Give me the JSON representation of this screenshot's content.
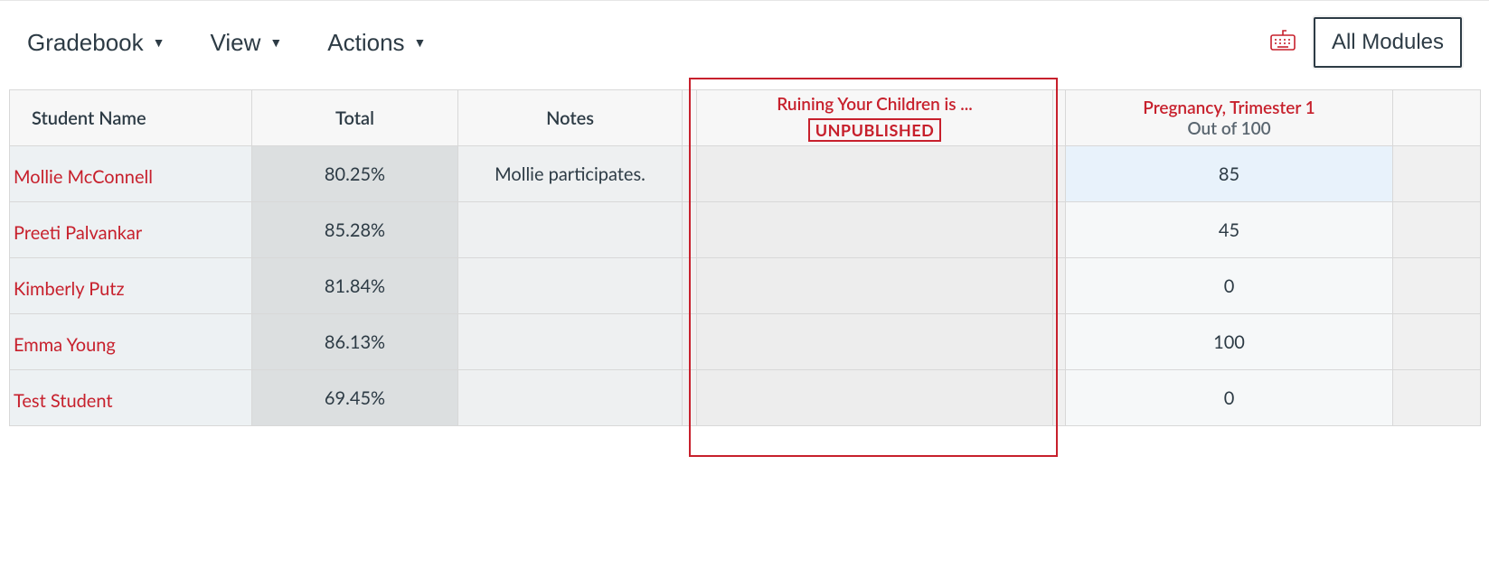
{
  "toolbar": {
    "gradebook_label": "Gradebook",
    "view_label": "View",
    "actions_label": "Actions",
    "all_modules_label": "All Modules"
  },
  "table": {
    "headers": {
      "student": "Student Name",
      "total": "Total",
      "notes": "Notes"
    },
    "assignments": [
      {
        "title": "Ruining Your Children is ...",
        "status": "UNPUBLISHED"
      },
      {
        "title": "Pregnancy, Trimester 1",
        "subtitle": "Out of 100"
      }
    ],
    "rows": [
      {
        "name": "Mollie McConnell",
        "total": "80.25%",
        "notes": "Mollie participates.",
        "a1": "",
        "a2": "85",
        "a2_highlight": true
      },
      {
        "name": "Preeti Palvankar",
        "total": "85.28%",
        "notes": "",
        "a1": "",
        "a2": "45"
      },
      {
        "name": "Kimberly Putz",
        "total": "81.84%",
        "notes": "",
        "a1": "",
        "a2": "0"
      },
      {
        "name": "Emma Young",
        "total": "86.13%",
        "notes": "",
        "a1": "",
        "a2": "100"
      },
      {
        "name": "Test Student",
        "total": "69.45%",
        "notes": "",
        "a1": "",
        "a2": "0"
      }
    ]
  }
}
